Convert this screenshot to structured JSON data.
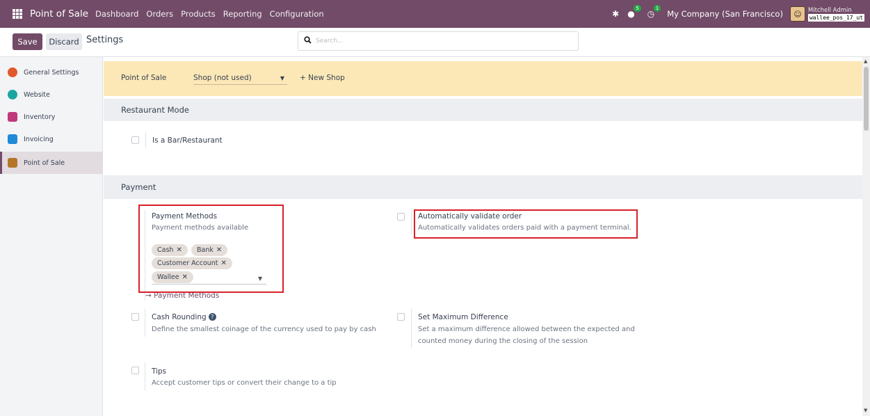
{
  "navbar": {
    "app_name": "Point of Sale",
    "menu": [
      "Dashboard",
      "Orders",
      "Products",
      "Reporting",
      "Configuration"
    ],
    "activity_count": "5",
    "clock_count": "1",
    "company": "My Company (San Francisco)",
    "user_name": "Mitchell Admin",
    "db_name": "wallee_pos_17_ut"
  },
  "control": {
    "save_label": "Save",
    "discard_label": "Discard",
    "title": "Settings",
    "search_placeholder": "Search..."
  },
  "sidebar": {
    "items": [
      {
        "label": "General Settings",
        "color": "#e05a2b"
      },
      {
        "label": "Website",
        "color": "#1aa6a0"
      },
      {
        "label": "Inventory",
        "color": "#c0397a"
      },
      {
        "label": "Invoicing",
        "color": "#1f8ad6"
      },
      {
        "label": "Point of Sale",
        "color": "#b5762a"
      }
    ],
    "active_index": 4
  },
  "shop_bar": {
    "label": "Point of Sale",
    "selected_shop": "Shop (not used)",
    "new_shop_label": "+ New Shop"
  },
  "sections": {
    "restaurant": {
      "title": "Restaurant Mode",
      "bar_restaurant_label": "Is a Bar/Restaurant"
    },
    "payment": {
      "title": "Payment",
      "payment_methods_title": "Payment Methods",
      "payment_methods_desc": "Payment methods available",
      "tags": [
        "Cash",
        "Bank",
        "Customer Account",
        "Wallee"
      ],
      "payment_methods_link": "→ Payment Methods",
      "auto_validate_title": "Automatically validate order",
      "auto_validate_desc": "Automatically validates orders paid with a payment terminal.",
      "cash_rounding_title": "Cash Rounding",
      "cash_rounding_desc": "Define the smallest coinage of the currency used to pay by cash",
      "max_diff_title": "Set Maximum Difference",
      "max_diff_desc_1": "Set a maximum difference allowed between the expected and",
      "max_diff_desc_2": "counted money during the closing of the session",
      "tips_title": "Tips",
      "tips_desc": "Accept customer tips or convert their change to a tip"
    }
  },
  "colors": {
    "brand": "#714b67",
    "highlight_box": "#d6212a",
    "shop_bar_bg": "#fce8b7"
  }
}
